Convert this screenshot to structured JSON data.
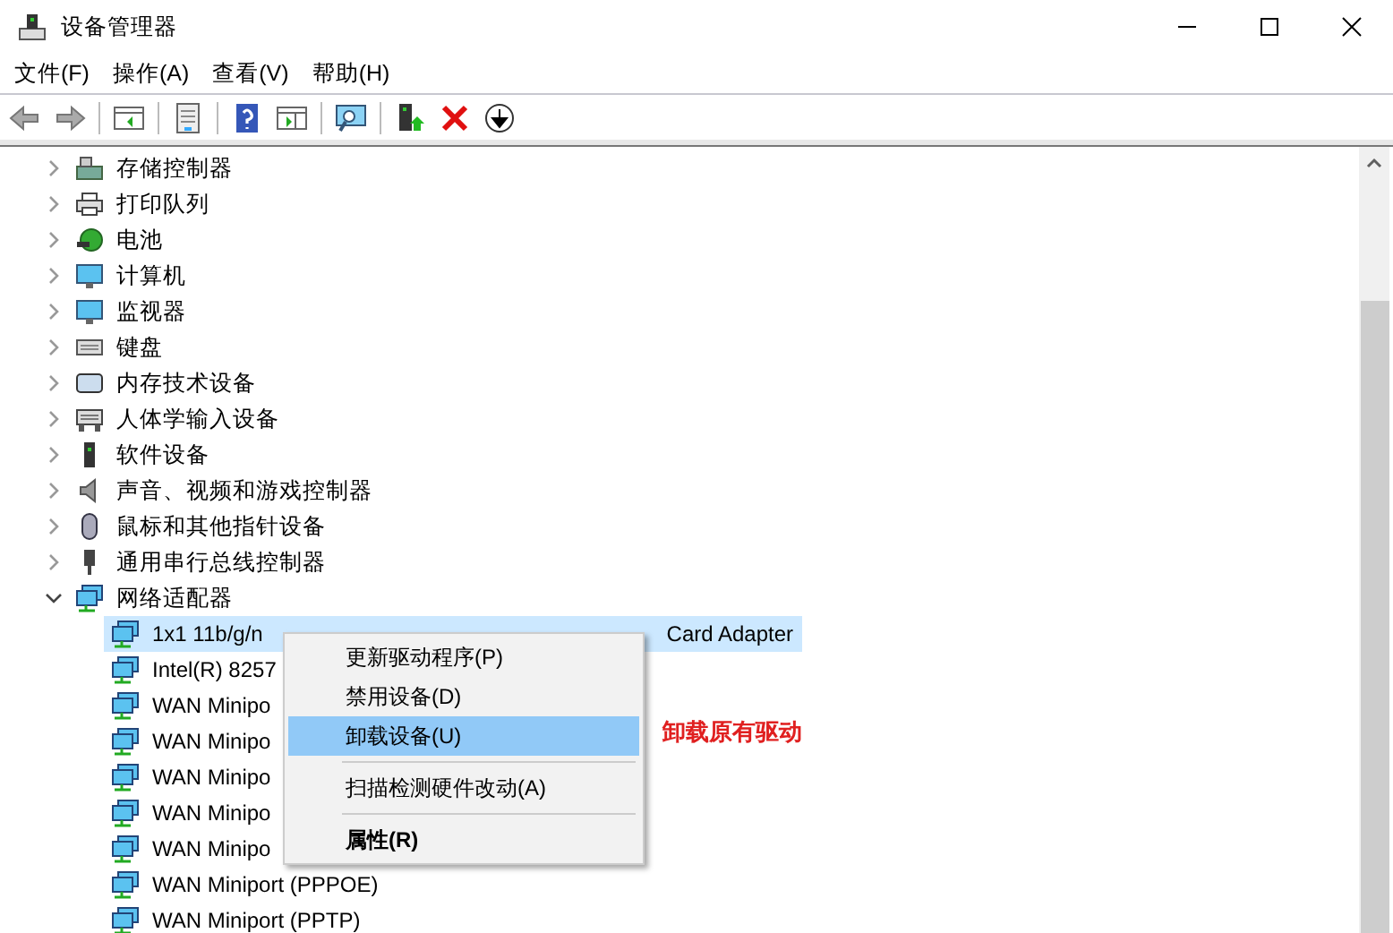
{
  "window": {
    "title": "设备管理器"
  },
  "menu_bar": [
    "文件(F)",
    "操作(A)",
    "查看(V)",
    "帮助(H)"
  ],
  "tree": {
    "items": [
      {
        "label": "存储控制器",
        "expanded": false
      },
      {
        "label": "打印队列",
        "expanded": false
      },
      {
        "label": "电池",
        "expanded": false
      },
      {
        "label": "计算机",
        "expanded": false
      },
      {
        "label": "监视器",
        "expanded": false
      },
      {
        "label": "键盘",
        "expanded": false
      },
      {
        "label": "内存技术设备",
        "expanded": false
      },
      {
        "label": "人体学输入设备",
        "expanded": false
      },
      {
        "label": "软件设备",
        "expanded": false
      },
      {
        "label": "声音、视频和游戏控制器",
        "expanded": false
      },
      {
        "label": "鼠标和其他指针设备",
        "expanded": false
      },
      {
        "label": "通用串行总线控制器",
        "expanded": false
      },
      {
        "label": "网络适配器",
        "expanded": true,
        "children": [
          {
            "label": "1x1 11b/g/n",
            "label_tail": "Card Adapter",
            "selected": true
          },
          {
            "label": "Intel(R) 8257",
            "selected": false
          },
          {
            "label": "WAN Minipo",
            "selected": false
          },
          {
            "label": "WAN Minipo",
            "selected": false
          },
          {
            "label": "WAN Minipo",
            "selected": false
          },
          {
            "label": "WAN Minipo",
            "selected": false
          },
          {
            "label": "WAN Minipo",
            "selected": false
          },
          {
            "label": "WAN Miniport (PPPOE)",
            "selected": false
          },
          {
            "label": "WAN Miniport (PPTP)",
            "selected": false
          }
        ]
      }
    ]
  },
  "context_menu": {
    "items": [
      {
        "kind": "item",
        "label": "更新驱动程序(P)",
        "selected": false,
        "default": false
      },
      {
        "kind": "item",
        "label": "禁用设备(D)",
        "selected": false,
        "default": false
      },
      {
        "kind": "item",
        "label": "卸载设备(U)",
        "selected": true,
        "default": false
      },
      {
        "kind": "separator"
      },
      {
        "kind": "item",
        "label": "扫描检测硬件改动(A)",
        "selected": false,
        "default": false
      },
      {
        "kind": "separator"
      },
      {
        "kind": "item",
        "label": "属性(R)",
        "selected": false,
        "default": true
      }
    ]
  },
  "annotation": "卸载原有驱动"
}
